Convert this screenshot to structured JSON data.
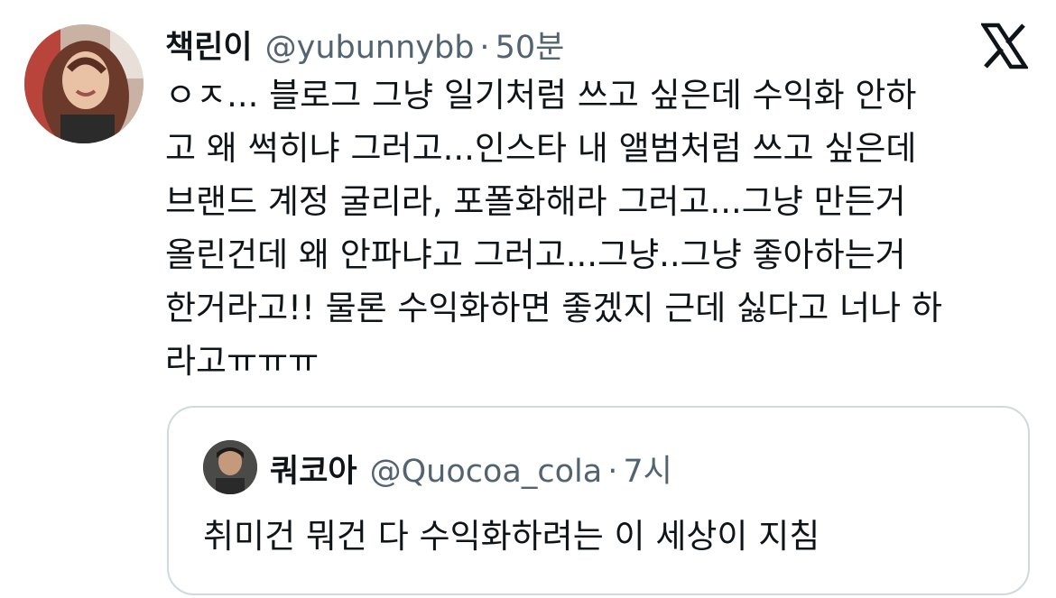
{
  "tweet": {
    "display_name": "책린이",
    "handle": "@yubunnybb",
    "separator": "·",
    "time": "50분",
    "avatar_icon": "user-avatar-photo",
    "platform_icon": "x-logo-icon",
    "text_lines": [
      "ㅇㅈ... 블로그 그냥 일기처럼 쓰고 싶은데 수익화 안하",
      "고 왜 썩히냐 그러고...인스타 내 앨범처럼 쓰고 싶은데",
      "브랜드 계정 굴리라, 포폴화해라 그러고...그냥 만든거",
      "올린건데 왜 안파냐고 그러고...그냥..그냥 좋아하는거",
      "한거라고!! 물론 수익화하면 좋겠지 근데 싫다고 너나 하",
      "라고ㅠㅠㅠ"
    ]
  },
  "quote": {
    "display_name": "쿼코아",
    "handle": "@Quocoa_cola",
    "separator": "·",
    "time": "7시",
    "avatar_icon": "quoted-user-avatar-photo",
    "text": "취미건 뭐건 다 수익화하려는 이 세상이 지침"
  },
  "colors": {
    "text_primary": "#0f1419",
    "text_secondary": "#536471",
    "card_border": "#cfd9de",
    "background": "#ffffff"
  }
}
